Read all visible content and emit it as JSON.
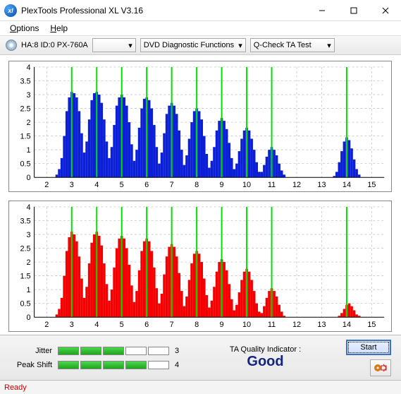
{
  "window": {
    "title": "PlexTools Professional XL V3.16"
  },
  "menu": {
    "options": "Options",
    "options_u": "O",
    "help": "Help",
    "help_u": "H"
  },
  "toolbar": {
    "drive": "HA:8 ID:0  PX-760A",
    "fn": "DVD Diagnostic Functions",
    "test": "Q-Check TA Test"
  },
  "metrics": {
    "jitter_label": "Jitter",
    "jitter_filled": 3,
    "jitter_count": "3",
    "peak_label": "Peak Shift",
    "peak_filled": 4,
    "peak_count": "4"
  },
  "quality": {
    "label": "TA Quality Indicator :",
    "value": "Good"
  },
  "buttons": {
    "start": "Start"
  },
  "status": {
    "text": "Ready"
  },
  "chart_data": [
    {
      "type": "bar",
      "color": "#0b1fd6",
      "xlim": [
        1.5,
        15.5
      ],
      "ylim": [
        0,
        4
      ],
      "xticks": [
        2,
        3,
        4,
        5,
        6,
        7,
        8,
        9,
        10,
        11,
        12,
        13,
        14,
        15
      ],
      "yticks": [
        0,
        0.5,
        1,
        1.5,
        2,
        2.5,
        3,
        3.5,
        4
      ],
      "markers": [
        3,
        4,
        5,
        6,
        7,
        8,
        9,
        10,
        11,
        14
      ],
      "step": 0.1,
      "bars": [
        [
          2.4,
          0.1
        ],
        [
          2.5,
          0.3
        ],
        [
          2.6,
          0.7
        ],
        [
          2.7,
          1.5
        ],
        [
          2.8,
          2.4
        ],
        [
          2.9,
          2.9
        ],
        [
          3.0,
          3.1
        ],
        [
          3.1,
          3.05
        ],
        [
          3.2,
          2.9
        ],
        [
          3.3,
          2.4
        ],
        [
          3.4,
          1.6
        ],
        [
          3.5,
          0.9
        ],
        [
          3.6,
          1.3
        ],
        [
          3.7,
          2.1
        ],
        [
          3.8,
          2.8
        ],
        [
          3.9,
          3.05
        ],
        [
          4.0,
          3.1
        ],
        [
          4.1,
          3.0
        ],
        [
          4.2,
          2.7
        ],
        [
          4.3,
          2.1
        ],
        [
          4.4,
          1.3
        ],
        [
          4.5,
          0.7
        ],
        [
          4.6,
          1.1
        ],
        [
          4.7,
          1.9
        ],
        [
          4.8,
          2.6
        ],
        [
          4.9,
          2.9
        ],
        [
          5.0,
          3.0
        ],
        [
          5.1,
          2.9
        ],
        [
          5.2,
          2.6
        ],
        [
          5.3,
          2.0
        ],
        [
          5.4,
          1.2
        ],
        [
          5.5,
          0.6
        ],
        [
          5.6,
          1.0
        ],
        [
          5.7,
          1.8
        ],
        [
          5.8,
          2.5
        ],
        [
          5.9,
          2.85
        ],
        [
          6.0,
          2.9
        ],
        [
          6.1,
          2.8
        ],
        [
          6.2,
          2.5
        ],
        [
          6.3,
          1.9
        ],
        [
          6.4,
          1.1
        ],
        [
          6.5,
          0.5
        ],
        [
          6.6,
          0.9
        ],
        [
          6.7,
          1.6
        ],
        [
          6.8,
          2.3
        ],
        [
          6.9,
          2.6
        ],
        [
          7.0,
          2.7
        ],
        [
          7.1,
          2.6
        ],
        [
          7.2,
          2.3
        ],
        [
          7.3,
          1.7
        ],
        [
          7.4,
          1.0
        ],
        [
          7.5,
          0.45
        ],
        [
          7.6,
          0.8
        ],
        [
          7.7,
          1.4
        ],
        [
          7.8,
          2.0
        ],
        [
          7.9,
          2.4
        ],
        [
          8.0,
          2.5
        ],
        [
          8.1,
          2.4
        ],
        [
          8.2,
          2.1
        ],
        [
          8.3,
          1.5
        ],
        [
          8.4,
          0.85
        ],
        [
          8.5,
          0.35
        ],
        [
          8.6,
          0.6
        ],
        [
          8.7,
          1.1
        ],
        [
          8.8,
          1.7
        ],
        [
          8.9,
          2.05
        ],
        [
          9.0,
          2.15
        ],
        [
          9.1,
          2.05
        ],
        [
          9.2,
          1.75
        ],
        [
          9.3,
          1.25
        ],
        [
          9.4,
          0.7
        ],
        [
          9.5,
          0.3
        ],
        [
          9.6,
          0.5
        ],
        [
          9.7,
          0.95
        ],
        [
          9.8,
          1.4
        ],
        [
          9.9,
          1.7
        ],
        [
          10.0,
          1.8
        ],
        [
          10.1,
          1.7
        ],
        [
          10.2,
          1.4
        ],
        [
          10.3,
          1.0
        ],
        [
          10.4,
          0.55
        ],
        [
          10.5,
          0.2
        ],
        [
          10.6,
          0.2
        ],
        [
          10.7,
          0.45
        ],
        [
          10.8,
          0.75
        ],
        [
          10.9,
          1.0
        ],
        [
          11.0,
          1.1
        ],
        [
          11.1,
          1.0
        ],
        [
          11.2,
          0.8
        ],
        [
          11.3,
          0.5
        ],
        [
          11.4,
          0.25
        ],
        [
          11.5,
          0.1
        ],
        [
          13.5,
          0.05
        ],
        [
          13.6,
          0.2
        ],
        [
          13.7,
          0.55
        ],
        [
          13.8,
          0.95
        ],
        [
          13.9,
          1.3
        ],
        [
          14.0,
          1.45
        ],
        [
          14.1,
          1.35
        ],
        [
          14.2,
          1.05
        ],
        [
          14.3,
          0.65
        ],
        [
          14.4,
          0.3
        ],
        [
          14.5,
          0.1
        ]
      ]
    },
    {
      "type": "bar",
      "color": "#f40000",
      "xlim": [
        1.5,
        15.5
      ],
      "ylim": [
        0,
        4
      ],
      "xticks": [
        2,
        3,
        4,
        5,
        6,
        7,
        8,
        9,
        10,
        11,
        12,
        13,
        14,
        15
      ],
      "yticks": [
        0,
        0.5,
        1,
        1.5,
        2,
        2.5,
        3,
        3.5,
        4
      ],
      "markers": [
        3,
        4,
        5,
        6,
        7,
        8,
        9,
        10,
        11,
        14
      ],
      "step": 0.1,
      "bars": [
        [
          2.4,
          0.1
        ],
        [
          2.5,
          0.3
        ],
        [
          2.6,
          0.7
        ],
        [
          2.7,
          1.5
        ],
        [
          2.8,
          2.4
        ],
        [
          2.9,
          2.9
        ],
        [
          3.0,
          3.1
        ],
        [
          3.1,
          3.0
        ],
        [
          3.2,
          2.75
        ],
        [
          3.3,
          2.2
        ],
        [
          3.4,
          1.4
        ],
        [
          3.5,
          0.7
        ],
        [
          3.6,
          1.1
        ],
        [
          3.7,
          1.95
        ],
        [
          3.8,
          2.7
        ],
        [
          3.9,
          3.0
        ],
        [
          4.0,
          3.1
        ],
        [
          4.1,
          2.95
        ],
        [
          4.2,
          2.6
        ],
        [
          4.3,
          1.95
        ],
        [
          4.4,
          1.2
        ],
        [
          4.5,
          0.6
        ],
        [
          4.6,
          1.0
        ],
        [
          4.7,
          1.8
        ],
        [
          4.8,
          2.5
        ],
        [
          4.9,
          2.85
        ],
        [
          5.0,
          2.95
        ],
        [
          5.1,
          2.85
        ],
        [
          5.2,
          2.5
        ],
        [
          5.3,
          1.9
        ],
        [
          5.4,
          1.15
        ],
        [
          5.5,
          0.55
        ],
        [
          5.6,
          0.95
        ],
        [
          5.7,
          1.7
        ],
        [
          5.8,
          2.4
        ],
        [
          5.9,
          2.75
        ],
        [
          6.0,
          2.85
        ],
        [
          6.1,
          2.75
        ],
        [
          6.2,
          2.4
        ],
        [
          6.3,
          1.8
        ],
        [
          6.4,
          1.05
        ],
        [
          6.5,
          0.5
        ],
        [
          6.6,
          0.85
        ],
        [
          6.7,
          1.55
        ],
        [
          6.8,
          2.2
        ],
        [
          6.9,
          2.55
        ],
        [
          7.0,
          2.65
        ],
        [
          7.1,
          2.55
        ],
        [
          7.2,
          2.2
        ],
        [
          7.3,
          1.6
        ],
        [
          7.4,
          0.95
        ],
        [
          7.5,
          0.4
        ],
        [
          7.6,
          0.75
        ],
        [
          7.7,
          1.35
        ],
        [
          7.8,
          1.95
        ],
        [
          7.9,
          2.3
        ],
        [
          8.0,
          2.4
        ],
        [
          8.1,
          2.3
        ],
        [
          8.2,
          2.0
        ],
        [
          8.3,
          1.4
        ],
        [
          8.4,
          0.8
        ],
        [
          8.5,
          0.35
        ],
        [
          8.6,
          0.6
        ],
        [
          8.7,
          1.1
        ],
        [
          8.8,
          1.65
        ],
        [
          8.9,
          2.0
        ],
        [
          9.0,
          2.1
        ],
        [
          9.1,
          2.0
        ],
        [
          9.2,
          1.7
        ],
        [
          9.3,
          1.2
        ],
        [
          9.4,
          0.65
        ],
        [
          9.5,
          0.25
        ],
        [
          9.6,
          0.45
        ],
        [
          9.7,
          0.9
        ],
        [
          9.8,
          1.35
        ],
        [
          9.9,
          1.65
        ],
        [
          10.0,
          1.75
        ],
        [
          10.1,
          1.65
        ],
        [
          10.2,
          1.35
        ],
        [
          10.3,
          0.95
        ],
        [
          10.4,
          0.5
        ],
        [
          10.5,
          0.2
        ],
        [
          10.6,
          0.15
        ],
        [
          10.7,
          0.4
        ],
        [
          10.8,
          0.7
        ],
        [
          10.9,
          0.95
        ],
        [
          11.0,
          1.05
        ],
        [
          11.1,
          0.95
        ],
        [
          11.2,
          0.75
        ],
        [
          11.3,
          0.45
        ],
        [
          11.4,
          0.2
        ],
        [
          11.5,
          0.05
        ],
        [
          13.7,
          0.05
        ],
        [
          13.8,
          0.15
        ],
        [
          13.9,
          0.3
        ],
        [
          14.0,
          0.45
        ],
        [
          14.1,
          0.5
        ],
        [
          14.2,
          0.4
        ],
        [
          14.3,
          0.25
        ],
        [
          14.4,
          0.1
        ],
        [
          14.5,
          0.05
        ]
      ]
    }
  ]
}
